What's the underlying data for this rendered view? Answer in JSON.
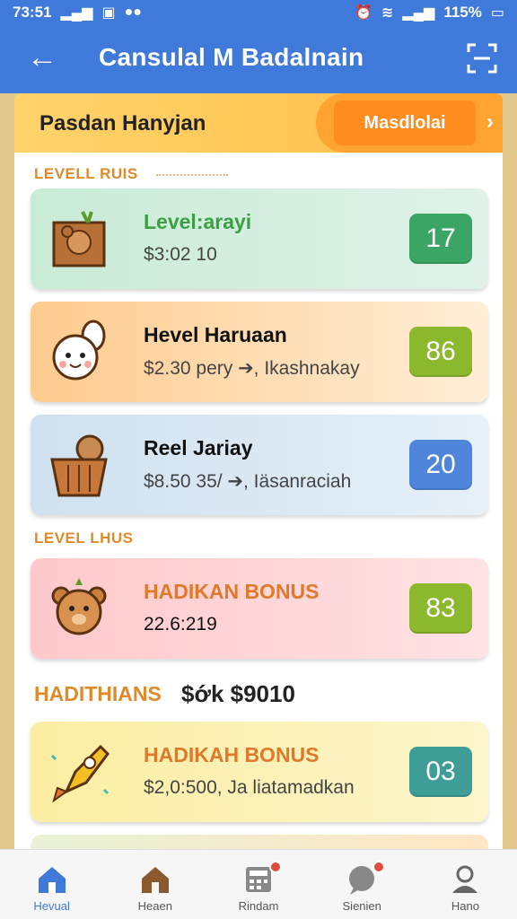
{
  "status_bar": {
    "time": "73:51",
    "battery": "115%",
    "icons_left": [
      "signal-icon",
      "app-icon",
      "chat-icon"
    ],
    "icons_right": [
      "alarm-icon",
      "wifi-icon",
      "signal-icon",
      "battery-icon"
    ]
  },
  "app_bar": {
    "title": "Cansulal M Badalnain",
    "back_icon": "arrow-left-icon",
    "action_icon": "scan-icon"
  },
  "header": {
    "title": "Pasdan Hanyjan",
    "button_label": "Masdlolai",
    "chevron": "›"
  },
  "sections": {
    "first_label": "LEVELL RUIS",
    "second_label": "LEVEL LHUS"
  },
  "items": [
    {
      "title": "Level:arayi",
      "subtitle": "$3:02 10",
      "badge": "17",
      "icon": "box-bear-icon"
    },
    {
      "title": "Hevel Haruaan",
      "subtitle": "$2.30 pery ➔, Ikashnakay",
      "badge": "86",
      "icon": "bunny-icon"
    },
    {
      "title": "Reel Jariay",
      "subtitle": "$8.50 35/ ➔, Iäsanraciah",
      "badge": "20",
      "icon": "basket-bear-icon"
    },
    {
      "title": "HADIKAN BONUS",
      "subtitle": "22.6:219",
      "badge": "83",
      "icon": "bear-icon"
    }
  ],
  "bonus": {
    "heading": "HADITHIANS",
    "amount": "$ớk $9010"
  },
  "bonus_item": {
    "title": "HADIKAH BONUS",
    "subtitle": "$2,0:500, Ja liatamadkan",
    "badge": "03",
    "icon": "rocket-icon"
  },
  "nav": [
    {
      "label": "Hevual",
      "icon": "home-icon",
      "active": true
    },
    {
      "label": "Heaen",
      "icon": "house-icon",
      "active": false
    },
    {
      "label": "Rindam",
      "icon": "calculator-icon",
      "active": false
    },
    {
      "label": "Sienien",
      "icon": "chat-bubble-icon",
      "active": false
    },
    {
      "label": "Hano",
      "icon": "user-icon",
      "active": false
    }
  ],
  "colors": {
    "primary": "#3f79d9",
    "accent_orange": "#ffa431",
    "badge_green": "#3aa565",
    "badge_olive": "#8cb82e",
    "badge_blue": "#4f86db",
    "badge_teal": "#3e9e97"
  }
}
